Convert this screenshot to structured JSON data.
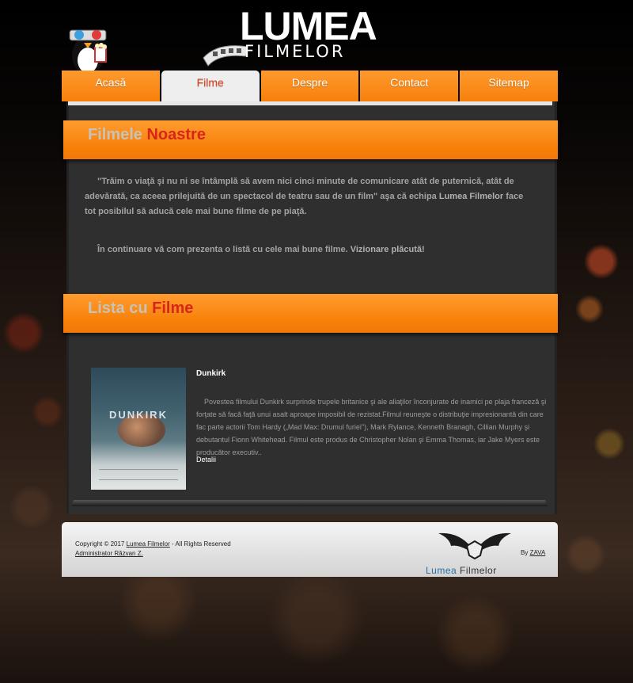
{
  "header": {
    "logo_top": "LUMEA",
    "logo_bottom": "FILMELOR"
  },
  "nav": {
    "tabs": [
      "Acasă",
      "Filme",
      "Despre",
      "Contact",
      "Sitemap"
    ],
    "active": "Filme"
  },
  "sections": {
    "ours": {
      "word1": "Filmele",
      "word2": "Noastre"
    },
    "list": {
      "word1": "Lista cu",
      "word2": "Filme"
    }
  },
  "intro": {
    "quote": "\"Trăim o viaţă şi nu ni se întâmplă să avem nici cinci minute de comunicare atât de puternică, atât de adevărată, ca aceea prilejuită de un spectacol de teatru sau de un film\" aşa că echipa",
    "team_name": "Lumea Filmelor",
    "quote_end": "face tot posibilul să aducă cele mai bune filme de pe piaţă.",
    "line2": "În continuare vă com prezenta o listă cu cele mai bune filme.",
    "line2_bold": "Vizionare plăcută!"
  },
  "movie": {
    "title": "Dunkirk",
    "poster_title": "DUNKIRK",
    "description": "Povestea filmului Dunkirk surprinde trupele britanice şi ale aliaţilor înconjurate de inamici pe plaja franceză şi forţate să facă faţă unui asalt aproape imposibil de rezistat.Filmul reuneşte o distribuţie impresionantă din care fac parte actorii Tom Hardy („Mad Max: Drumul furiei\"), Mark Rylance, Kenneth Branagh, Cillian Murphy şi debutantul Fionn Whitehead. Filmul este produs de Christopher Nolan şi Emma Thomas, iar Jake Myers este producător executiv..",
    "link": "Detalii"
  },
  "footer": {
    "copyright_prefix": "Copyright © 2017",
    "site_link": "Lumea Filmelor",
    "copyright_suffix": "- All Rights Reserved",
    "admin": "Administrator Răzvan Z.",
    "logo_word1": "Lumea",
    "logo_word2": "Filmelor",
    "by_prefix": "By",
    "by_link": "ZAVA"
  },
  "colors": {
    "accent_orange": "#f78009",
    "title_red": "#d8251a",
    "panel_bg": "#2f2f2f"
  }
}
